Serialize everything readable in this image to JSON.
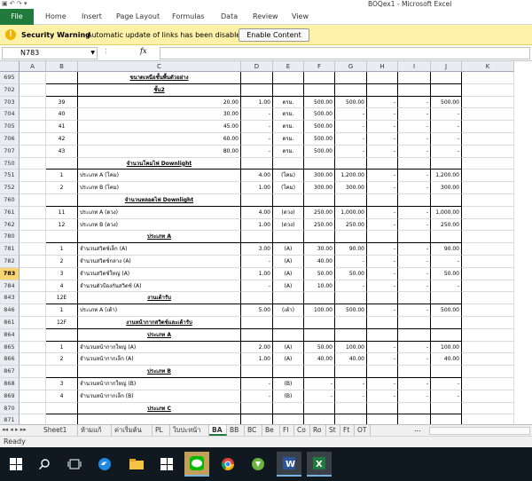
{
  "window": {
    "title": "BOQex1 - Microsoft Excel"
  },
  "ribbon": {
    "file": "File",
    "tabs": [
      "Home",
      "Insert",
      "Page Layout",
      "Formulas",
      "Data",
      "Review",
      "View"
    ]
  },
  "security_bar": {
    "title": "Security Warning",
    "message": "Automatic update of links has been disabled",
    "button": "Enable Content"
  },
  "formula_bar": {
    "name_box": "N783",
    "fx": "fx",
    "formula": ""
  },
  "columns": [
    "A",
    "B",
    "C",
    "D",
    "E",
    "F",
    "G",
    "H",
    "I",
    "J",
    "K"
  ],
  "rows": [
    {
      "num": "695",
      "b": "",
      "c": "ขนาดเหนือชั้นพื้นตัวอย่าง",
      "d": "",
      "e": "",
      "f": "",
      "g": "",
      "h": "",
      "i": "",
      "j": "",
      "style": "heading"
    },
    {
      "num": "702",
      "b": "",
      "c": "ชั้น2",
      "d": "",
      "e": "",
      "f": "",
      "g": "",
      "h": "",
      "i": "",
      "j": "",
      "style": "heading"
    },
    {
      "num": "703",
      "b": "39",
      "c": "20.00",
      "d": "1.00",
      "e": "ตรม.",
      "f": "500.00",
      "g": "500.00",
      "h": "-",
      "i": "-",
      "j": "500.00",
      "style": ""
    },
    {
      "num": "704",
      "b": "40",
      "c": "30.00",
      "d": "-",
      "e": "ตรม.",
      "f": "500.00",
      "g": "-",
      "h": "-",
      "i": "-",
      "j": "-",
      "style": ""
    },
    {
      "num": "705",
      "b": "41",
      "c": "45.00",
      "d": "-",
      "e": "ตรม.",
      "f": "500.00",
      "g": "-",
      "h": "-",
      "i": "-",
      "j": "-",
      "style": ""
    },
    {
      "num": "706",
      "b": "42",
      "c": "60.00",
      "d": "-",
      "e": "ตรม.",
      "f": "500.00",
      "g": "-",
      "h": "-",
      "i": "-",
      "j": "-",
      "style": ""
    },
    {
      "num": "707",
      "b": "43",
      "c": "80.00",
      "d": "-",
      "e": "ตรม.",
      "f": "500.00",
      "g": "-",
      "h": "-",
      "i": "-",
      "j": "-",
      "style": ""
    },
    {
      "num": "750",
      "b": "",
      "c": "จำนวนโคมไฟ Downlight",
      "d": "",
      "e": "",
      "f": "",
      "g": "",
      "h": "",
      "i": "",
      "j": "",
      "style": "heading"
    },
    {
      "num": "751",
      "b": "1",
      "c": "ประเภท A (โคม)",
      "d": "4.00",
      "e": "(โคม)",
      "f": "300.00",
      "g": "1,200.00",
      "h": "-",
      "i": "-",
      "j": "1,200.00",
      "style": "left"
    },
    {
      "num": "752",
      "b": "2",
      "c": "ประเภท B (โคม)",
      "d": "1.00",
      "e": "(โคม)",
      "f": "300.00",
      "g": "300.00",
      "h": "-",
      "i": "-",
      "j": "300.00",
      "style": "left"
    },
    {
      "num": "760",
      "b": "",
      "c": "จำนวนหลอดไฟ Downlight",
      "d": "",
      "e": "",
      "f": "",
      "g": "",
      "h": "",
      "i": "",
      "j": "",
      "style": "heading"
    },
    {
      "num": "761",
      "b": "11",
      "c": "ประเภท A (ดวง)",
      "d": "4.00",
      "e": "(ดวง)",
      "f": "250.00",
      "g": "1,000.00",
      "h": "-",
      "i": "-",
      "j": "1,000.00",
      "style": "left"
    },
    {
      "num": "762",
      "b": "12",
      "c": "ประเภท B (ดวง)",
      "d": "1.00",
      "e": "(ดวง)",
      "f": "250.00",
      "g": "250.00",
      "h": "-",
      "i": "-",
      "j": "250.00",
      "style": "left"
    },
    {
      "num": "780",
      "b": "",
      "c": "ประเภท A",
      "d": "",
      "e": "",
      "f": "",
      "g": "",
      "h": "",
      "i": "",
      "j": "",
      "style": "heading"
    },
    {
      "num": "781",
      "b": "1",
      "c": "จำนวนสวิตช์เล็ก (A)",
      "d": "3.00",
      "e": "(A)",
      "f": "30.00",
      "g": "90.00",
      "h": "-",
      "i": "-",
      "j": "90.00",
      "style": "left"
    },
    {
      "num": "782",
      "b": "2",
      "c": "จำนวนสวิตช์กลาง (A)",
      "d": "-",
      "e": "(A)",
      "f": "40.00",
      "g": "-",
      "h": "-",
      "i": "-",
      "j": "-",
      "style": "left"
    },
    {
      "num": "783",
      "b": "3",
      "c": "จำนวนสวิตช์ใหญ่ (A)",
      "d": "1.00",
      "e": "(A)",
      "f": "50.00",
      "g": "50.00",
      "h": "-",
      "i": "-",
      "j": "50.00",
      "style": "left"
    },
    {
      "num": "784",
      "b": "4",
      "c": "จำนวนตัวป้องกันสวิตช์ (A)",
      "d": "-",
      "e": "(A)",
      "f": "10.00",
      "g": "-",
      "h": "-",
      "i": "-",
      "j": "-",
      "style": "left"
    },
    {
      "num": "843",
      "b": "12E",
      "c": "งานเต้ารับ",
      "d": "",
      "e": "",
      "f": "",
      "g": "",
      "h": "",
      "i": "",
      "j": "",
      "style": "heading"
    },
    {
      "num": "846",
      "b": "1",
      "c": "ประเภท A (เต้า)",
      "d": "5.00",
      "e": "(เต้า)",
      "f": "100.00",
      "g": "500.00",
      "h": "-",
      "i": "-",
      "j": "500.00",
      "style": "left"
    },
    {
      "num": "861",
      "b": "12F",
      "c": "งานหน้ากากสวิตช์และเต้ารับ",
      "d": "",
      "e": "",
      "f": "",
      "g": "",
      "h": "",
      "i": "",
      "j": "",
      "style": "heading"
    },
    {
      "num": "864",
      "b": "",
      "c": "ประเภท A",
      "d": "",
      "e": "",
      "f": "",
      "g": "",
      "h": "",
      "i": "",
      "j": "",
      "style": "heading"
    },
    {
      "num": "865",
      "b": "1",
      "c": "จำนวนหน้ากากใหญ่ (A)",
      "d": "2.00",
      "e": "(A)",
      "f": "50.00",
      "g": "100.00",
      "h": "-",
      "i": "-",
      "j": "100.00",
      "style": "left"
    },
    {
      "num": "866",
      "b": "2",
      "c": "จำนวนหน้ากากเล็ก (A)",
      "d": "1.00",
      "e": "(A)",
      "f": "40.00",
      "g": "40.00",
      "h": "-",
      "i": "-",
      "j": "40.00",
      "style": "left"
    },
    {
      "num": "867",
      "b": "",
      "c": "ประเภท B",
      "d": "",
      "e": "",
      "f": "",
      "g": "",
      "h": "",
      "i": "",
      "j": "",
      "style": "heading"
    },
    {
      "num": "868",
      "b": "3",
      "c": "จำนวนหน้ากากใหญ่ (B)",
      "d": "-",
      "e": "(B)",
      "f": "-",
      "g": "-",
      "h": "-",
      "i": "-",
      "j": "-",
      "style": "left"
    },
    {
      "num": "869",
      "b": "4",
      "c": "จำนวนหน้ากากเล็ก (B)",
      "d": "-",
      "e": "(B)",
      "f": "-",
      "g": "-",
      "h": "-",
      "i": "-",
      "j": "-",
      "style": "left"
    },
    {
      "num": "870",
      "b": "",
      "c": "ประเภท C",
      "d": "",
      "e": "",
      "f": "",
      "g": "",
      "h": "",
      "i": "",
      "j": "",
      "style": "heading"
    },
    {
      "num": "871",
      "b": "",
      "c": "",
      "d": "",
      "e": "",
      "f": "",
      "g": "",
      "h": "",
      "i": "",
      "j": "",
      "style": ""
    }
  ],
  "selected_row": "783",
  "sheet_tabs": [
    "Sheet1",
    "ห้ามแก้",
    "ค่าเริ่มต้น",
    "PL",
    "ใบปะหน้า",
    "BA",
    "BB",
    "BC",
    "Be",
    "Fl",
    "Co",
    "Ro",
    "St",
    "Ft",
    "OT"
  ],
  "active_sheet": "BA",
  "tabs_more": "...",
  "status": {
    "text": "Ready"
  },
  "taskbar_icons": [
    "windows-start-icon",
    "search-icon",
    "task-view-icon",
    "edge-icon",
    "file-explorer-icon",
    "store-icon",
    "line-app-icon",
    "chrome-icon",
    "torrent-icon",
    "word-icon",
    "excel-icon"
  ],
  "colors": {
    "excel_green": "#1f7a3c",
    "warning_bg": "#fff1a8",
    "taskbar": "#101820",
    "selected_row": "#f8d770"
  }
}
